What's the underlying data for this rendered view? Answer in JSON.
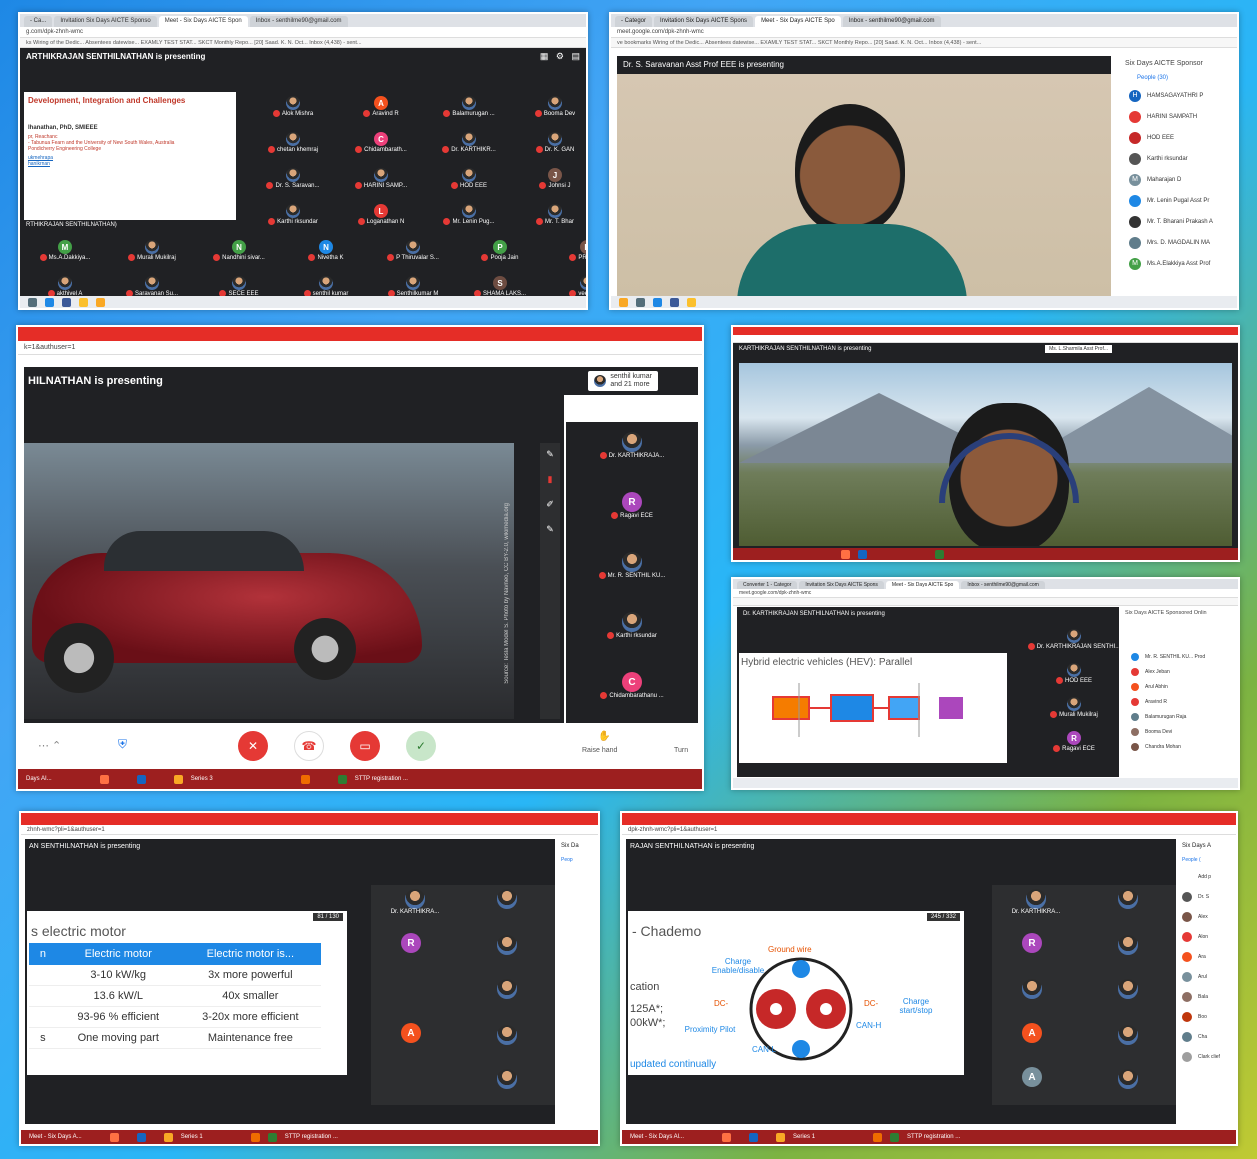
{
  "p1": {
    "tabs": [
      "- Ca...",
      "Invitation Six Days AICTE Sponso",
      "Meet - Six Days AICTE Spon",
      "Inbox - senthilme90@gmail.com"
    ],
    "addr": "g.com/dpk-zhnh-wmc",
    "bookmarks": "ks    Wiring of the Dedic...    Absentees datewise...    EXAMLY TEST STAT...    SKCT Monthly Repo...    [20] Saad. K. N. Oct...    Inbox (4,438) - sent...",
    "presenting": "ARTHIKRAJAN SENTHILNATHAN is presenting",
    "slide_title": "Development, Integration and Challenges",
    "slide_author": "Ihanathan, PhD, SMIEEE",
    "slide_lines": [
      "pr, Reachanc",
      "- Tabunua Fearn and the University of New South Wales, Australia",
      "Pondicherry Engineering College"
    ],
    "slide_links": [
      "ukmehrapa",
      "hanikrnan"
    ],
    "slide_caption": "RTHIKRAJAN SENTHILNATHAN)",
    "tiles": [
      {
        "n": "Alok Mishra",
        "t": "photo"
      },
      {
        "n": "Aravind R",
        "t": "A",
        "c": "#f4511e"
      },
      {
        "n": "Balamurugan ...",
        "t": "photo"
      },
      {
        "n": "Booma Dev",
        "t": "photo"
      },
      {
        "n": "chetan khemraj",
        "t": "photo"
      },
      {
        "n": "Chidambarath...",
        "t": "C",
        "c": "#ec407a"
      },
      {
        "n": "Dr. KARTHIKR...",
        "t": "photo"
      },
      {
        "n": "Dr. K. GAN",
        "t": "photo"
      },
      {
        "n": "Dr. S. Saravan...",
        "t": "photo"
      },
      {
        "n": "HARINI SAMP...",
        "t": "photo"
      },
      {
        "n": "HOD EEE",
        "t": "photo"
      },
      {
        "n": "Johnsi J",
        "t": "J",
        "c": "#795548"
      },
      {
        "n": "Karthi rksundar",
        "t": "photo"
      },
      {
        "n": "Loganathan N",
        "t": "L",
        "c": "#e53935"
      },
      {
        "n": "Mr. Lenin Pug...",
        "t": "photo"
      },
      {
        "n": "Mr. T. Bhar",
        "t": "photo"
      },
      {
        "n": "Ms.A.Dakkiya...",
        "t": "M",
        "c": "#43a047"
      },
      {
        "n": "Murali Mukilraj",
        "t": "photo"
      },
      {
        "n": "Nandhini sivar...",
        "t": "N",
        "c": "#43a047"
      },
      {
        "n": "Nivetha K",
        "t": "N",
        "c": "#1e88e5"
      },
      {
        "n": "P Thiruvalar S...",
        "t": "photo"
      },
      {
        "n": "Pooja Jain",
        "t": "P",
        "c": "#43a047"
      },
      {
        "n": "PRIYADH",
        "t": "P",
        "c": "#795548"
      },
      {
        "n": "akthivel A",
        "t": "photo"
      },
      {
        "n": "Saravanan Su...",
        "t": "photo"
      },
      {
        "n": "SECE EEE",
        "t": "photo"
      },
      {
        "n": "senthil kumar",
        "t": "photo"
      },
      {
        "n": "Senthilkumar M",
        "t": "photo"
      },
      {
        "n": "SHAMA LAKS...",
        "t": "S",
        "c": "#6d4c41"
      },
      {
        "n": "veerasam",
        "t": "photo"
      }
    ]
  },
  "p2": {
    "tabs": [
      "- Categor",
      "Invitation Six Days AICTE Spons",
      "Meet - Six Days AICTE Spo",
      "Inbox - senthilme90@gmail.com"
    ],
    "addr": "meet.google.com/dpk-zhnh-wmc",
    "bookmarks": "ve bookmarks    Wiring of the Dedic...    Absentees datewise...    EXAMLY TEST STAT...    SKCT Monthly Repo...    [20] Saad. K. N. Oct...    Inbox (4,438) - sent...",
    "presenting": "Dr. S. Saravanan Asst Prof EEE is presenting",
    "side_title": "Six Days AICTE Sponsor",
    "people_tab": "People (30)",
    "people": [
      {
        "n": "HAMSAGAYATHRI P",
        "c": "#1565c0",
        "l": "H"
      },
      {
        "n": "HARINI SAMPATH",
        "c": "#e53935",
        "l": ""
      },
      {
        "n": "HOD EEE",
        "c": "#c62828",
        "l": ""
      },
      {
        "n": "Karthi rksundar",
        "c": "#555",
        "l": ""
      },
      {
        "n": "Maharajan D",
        "c": "#78909c",
        "l": "M"
      },
      {
        "n": "Mr. Lenin Pugal Asst Pr",
        "c": "#1e88e5",
        "l": ""
      },
      {
        "n": "Mr. T. Bharani Prakash A",
        "c": "#333",
        "l": ""
      },
      {
        "n": "Mrs. D. MAGDALIN MA",
        "c": "#607d8b",
        "l": ""
      },
      {
        "n": "Ms.A.Elakkiya Asst Prof",
        "c": "#43a047",
        "l": "M"
      }
    ]
  },
  "p3": {
    "addr": "k=1&authuser=1",
    "presenting": "HILNATHAN is presenting",
    "others": "senthil kumar",
    "others2": "and 21 more",
    "source": "Source: Tesla Model S. Photo by Navneo, CC BY-2.0, wikimedia.org",
    "tiles": [
      {
        "n": "Dr. KARTHIKRAJA...",
        "t": "photo"
      },
      {
        "n": "Ragavi ECE",
        "t": "R",
        "c": "#ab47bc"
      },
      {
        "n": "Mr. R. SENTHIL KU...",
        "t": "photo"
      },
      {
        "n": "Karthi rksundar",
        "t": "photo"
      },
      {
        "n": "Chidambarathanu ...",
        "t": "C",
        "c": "#ec407a"
      }
    ],
    "raise": "Raise hand",
    "turn": "Turn",
    "taskbar": [
      "Days AI...",
      "Series 3",
      "STTP registration ..."
    ]
  },
  "p4": {
    "presenting": "KARTHIKRAJAN SENTHILNATHAN is presenting",
    "badge": "Ms. L.Sharmila Asst Prof..."
  },
  "p5": {
    "tabs": [
      "Converter 1 - Categor",
      "Invitation Six Days AICTE Spons",
      "Meet - Six Days AICTE Spo",
      "Inbox - senthilme90@gmail.com"
    ],
    "addr": "meet.google.com/dpk-zhnh-wmc",
    "presenting": "Dr. KARTHIKRAJAN SENTHILNATHAN is presenting",
    "slide_title": "Hybrid electric vehicles (HEV): Parallel",
    "side_title": "Six Days AICTE Sponsored Onlin",
    "tiles": [
      {
        "n": "Dr. KARTHIKRAJAN SENTHI...",
        "t": "photo"
      },
      {
        "n": "HOD EEE",
        "t": "photo"
      },
      {
        "n": "Murali Mukilraj",
        "t": "photo"
      },
      {
        "n": "Ragavi ECE",
        "t": "R",
        "c": "#ab47bc"
      }
    ],
    "people": [
      "Mr. R. SENTHIL KU... Prod",
      "Alex Jeban",
      "Arul Abhin",
      "Aravind R",
      "Balamurugan Raja",
      "Booma Devi",
      "Chandra Mohan"
    ]
  },
  "p6": {
    "addr": "zhnh-wmc?pli=1&authuser=1",
    "presenting": "AN SENTHILNATHAN is presenting",
    "page": "81 / 130",
    "slide_title": "s electric motor",
    "head": [
      "n",
      "Electric motor",
      "Electric motor is..."
    ],
    "rows": [
      [
        "",
        "3-10 kW/kg",
        "3x more powerful"
      ],
      [
        "",
        "13.6 kW/L",
        "40x smaller"
      ],
      [
        "",
        "93-96 % efficient",
        "3-20x more efficient"
      ],
      [
        "s",
        "One moving part",
        "Maintenance free"
      ]
    ],
    "side": "Six Da",
    "side2": "Peop",
    "tile": "Dr. KARTHIKRA...",
    "taskbar": [
      "Meet - Six Days A...",
      "Series 1",
      "STTP registration ..."
    ]
  },
  "p7": {
    "addr": "dpk-zhnh-wmc?pli=1&authuser=1",
    "presenting": "RAJAN SENTHILNATHAN is presenting",
    "page": "245 / 332",
    "slide_title": "- Chademo",
    "labels": {
      "ground": "Ground wire",
      "charge": "Charge Enable/disable",
      "dc1": "DC-",
      "dc2": "DC-",
      "cs": "Charge start/stop",
      "prox": "Proximity Pilot",
      "canl": "CAN-L",
      "canh": "CAN-H"
    },
    "left": [
      "cation",
      "125A*;",
      "00kW*;"
    ],
    "updated": "updated continually",
    "side": "Six Days A",
    "side2": "People (",
    "side_names": [
      "Add p",
      "Dr. S",
      "Alex",
      "Alon",
      "Ara",
      "Arul",
      "Bala",
      "Boo",
      "Cha",
      "Clark clief"
    ],
    "tile": "Dr. KARTHIKRA...",
    "taskbar": [
      "Meet - Six Days Al...",
      "Series 1",
      "STTP registration ..."
    ]
  }
}
